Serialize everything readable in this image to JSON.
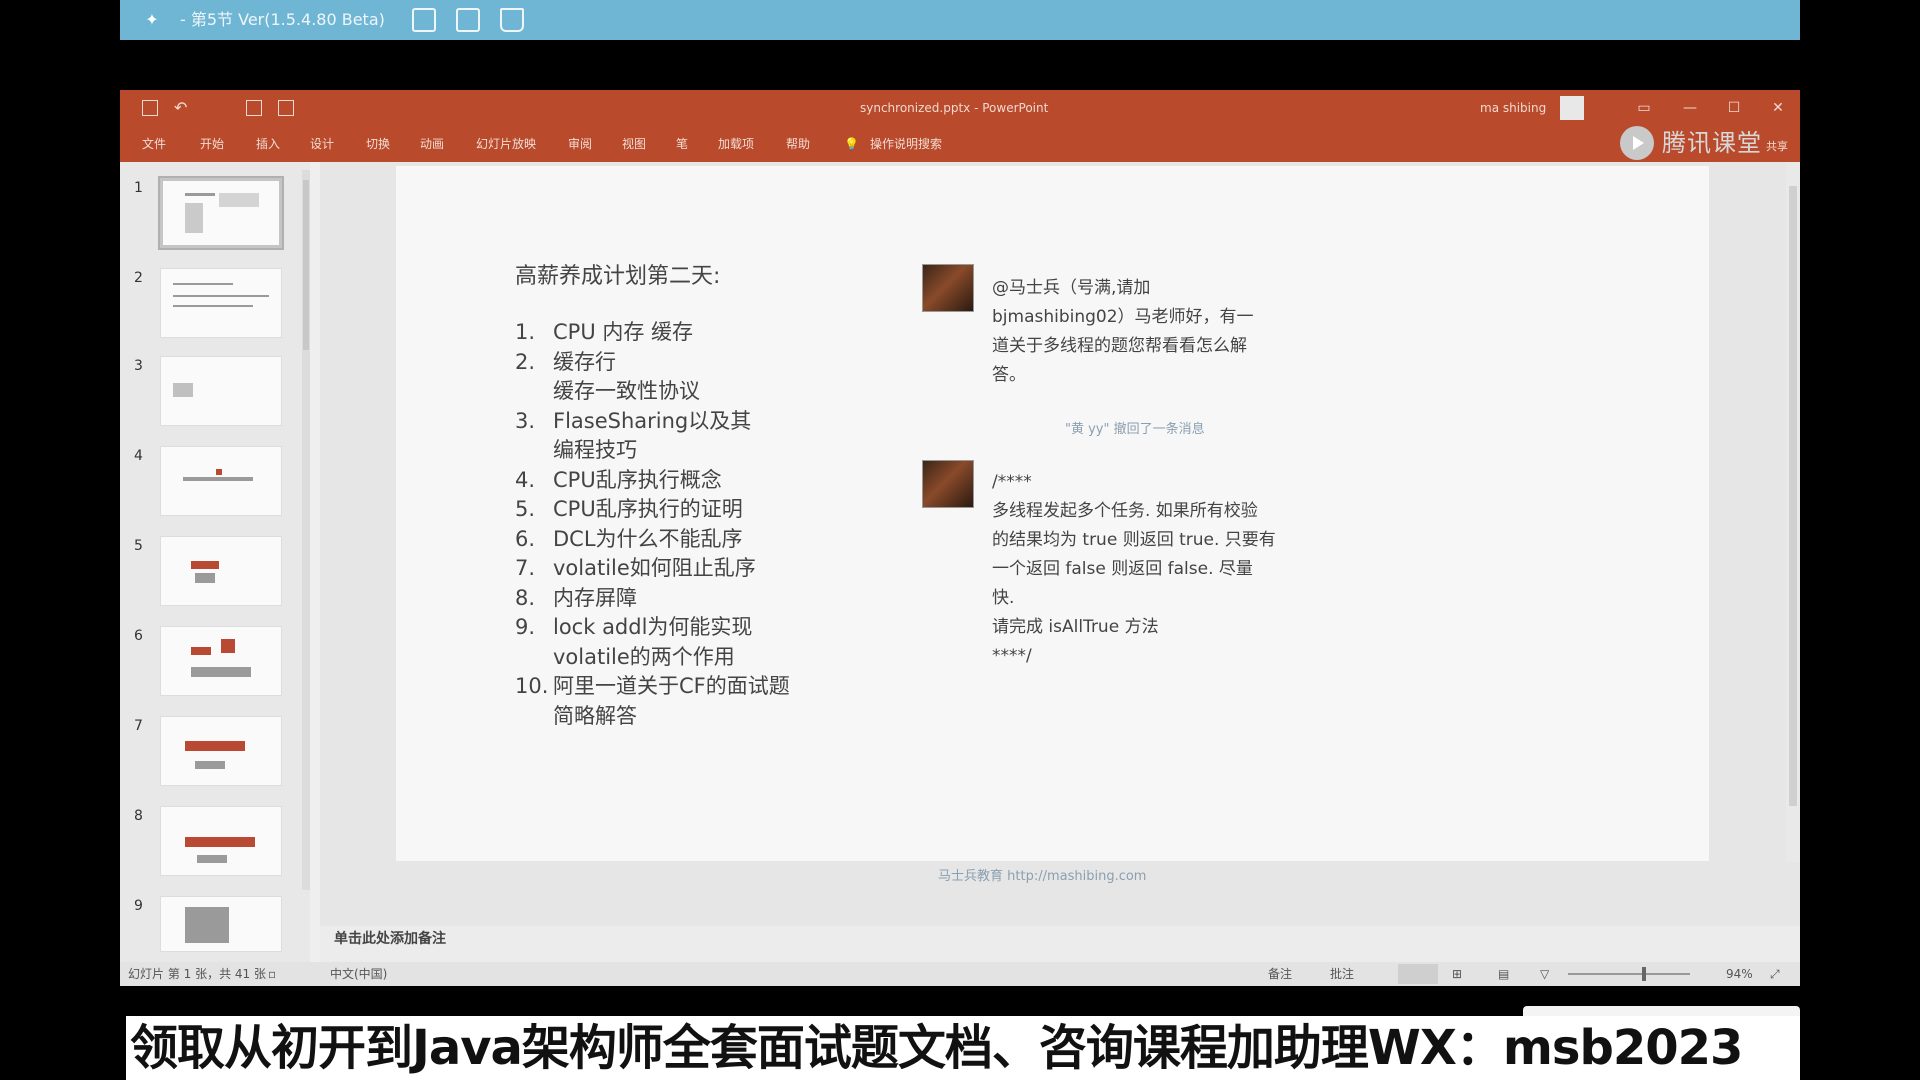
{
  "player": {
    "title": "- 第5节 Ver(1.5.4.80 Beta)",
    "icons": [
      "logo-icon",
      "edit-icon",
      "share-icon",
      "home-icon"
    ]
  },
  "ppt": {
    "file_title": "synchronized.pptx - PowerPoint",
    "user": "ma shibing",
    "tabs": [
      "文件",
      "开始",
      "插入",
      "设计",
      "切换",
      "动画",
      "幻灯片放映",
      "审阅",
      "视图",
      "笔",
      "加载项",
      "帮助",
      "操作说明搜索"
    ],
    "watermark": "腾讯课堂",
    "share_label": "共享"
  },
  "thumbnails": [
    "1",
    "2",
    "3",
    "4",
    "5",
    "6",
    "7",
    "8",
    "9"
  ],
  "slide": {
    "heading": "高薪养成计划第二天:",
    "items": [
      {
        "n": "1.",
        "text": "CPU 内存 缓存"
      },
      {
        "n": "2.",
        "text": "缓存行"
      },
      {
        "n": "",
        "text": "缓存一致性协议"
      },
      {
        "n": "3.",
        "text": "FlaseSharing以及其"
      },
      {
        "n": "",
        "text": "编程技巧"
      },
      {
        "n": "4.",
        "text": "CPU乱序执行概念"
      },
      {
        "n": "5.",
        "text": "CPU乱序执行的证明"
      },
      {
        "n": "6.",
        "text": "DCL为什么不能乱序"
      },
      {
        "n": "7.",
        "text": "volatile如何阻止乱序"
      },
      {
        "n": "8.",
        "text": "内存屏障"
      },
      {
        "n": "9.",
        "text": "lock addl为何能实现"
      },
      {
        "n": "",
        "text": "volatile的两个作用"
      },
      {
        "n": "10.",
        "text": "阿里一道关于CF的面试题"
      },
      {
        "n": "",
        "text": "简略解答"
      }
    ],
    "chat1": [
      "@马士兵（号满,请加",
      "bjmashibing02）马老师好，有一",
      "道关于多线程的题您帮看看怎么解",
      "答。"
    ],
    "recall_notice": "\"黄 yy\" 撤回了一条消息",
    "chat2": [
      "/****",
      "多线程发起多个任务. 如果所有校验",
      "的结果均为 true 则返回 true. 只要有",
      "一个返回 false 则返回 false. 尽量",
      "快.",
      "请完成 isAllTrue 方法",
      "****/"
    ],
    "footer": "马士兵教育 http://mashibing.com"
  },
  "notes_placeholder": "单击此处添加备注",
  "status": {
    "slide_info": "幻灯片 第 1 张，共 41 张",
    "language": "中文(中国)",
    "notes": "备注",
    "comments": "批注",
    "zoom": "94%"
  },
  "banner": "领取从初开到Java架构师全套面试题文档、咨询课程加助理WX：msb2023"
}
